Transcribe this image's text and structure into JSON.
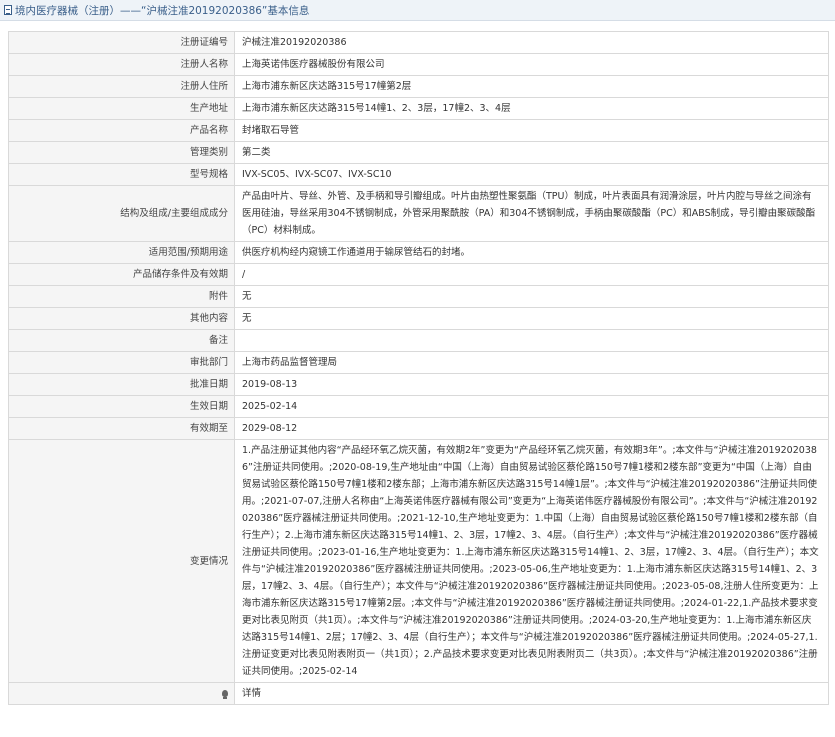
{
  "header": {
    "title": "境内医疗器械（注册）——“沪械注准20192020386”基本信息"
  },
  "rows": [
    {
      "label": "注册证编号",
      "value": "沪械注准20192020386"
    },
    {
      "label": "注册人名称",
      "value": "上海英诺伟医疗器械股份有限公司"
    },
    {
      "label": "注册人住所",
      "value": "上海市浦东新区庆达路315号17幢第2层"
    },
    {
      "label": "生产地址",
      "value": "上海市浦东新区庆达路315号14幢1、2、3层，17幢2、3、4层"
    },
    {
      "label": "产品名称",
      "value": "封堵取石导管"
    },
    {
      "label": "管理类别",
      "value": "第二类"
    },
    {
      "label": "型号规格",
      "value": "IVX-SC05、IVX-SC07、IVX-SC10"
    },
    {
      "label": "结构及组成/主要组成成分",
      "value": "产品由叶片、导丝、外管、及手柄和导引瓣组成。叶片由热塑性聚氨酯（TPU）制成，叶片表面具有润滑涂层，叶片内腔与导丝之间涂有医用硅油，导丝采用304不锈钢制成，外管采用聚酰胺（PA）和304不锈钢制成，手柄由聚碳酸酯（PC）和ABS制成，导引瓣由聚碳酸酯（PC）材料制成。"
    },
    {
      "label": "适用范围/预期用途",
      "value": "供医疗机构经内窥镜工作通道用于输尿管结石的封堵。"
    },
    {
      "label": "产品储存条件及有效期",
      "value": "/"
    },
    {
      "label": "附件",
      "value": "无"
    },
    {
      "label": "其他内容",
      "value": "无"
    },
    {
      "label": "备注",
      "value": ""
    },
    {
      "label": "审批部门",
      "value": "上海市药品监督管理局"
    },
    {
      "label": "批准日期",
      "value": "2019-08-13"
    },
    {
      "label": "生效日期",
      "value": "2025-02-14"
    },
    {
      "label": "有效期至",
      "value": "2029-08-12"
    },
    {
      "label": "变更情况",
      "value": "1.产品注册证其他内容“产品经环氧乙烷灭菌，有效期2年”变更为“产品经环氧乙烷灭菌，有效期3年”。;本文件与“沪械注准20192020386”注册证共同使用。;2020-08-19,生产地址由“中国（上海）自由贸易试验区蔡伦路150号7幢1楼和2楼东部”变更为“中国（上海）自由贸易试验区蔡伦路150号7幢1楼和2楼东部；上海市浦东新区庆达路315号14幢1层”。;本文件与“沪械注准20192020386”注册证共同使用。;2021-07-07,注册人名称由“上海英诺伟医疗器械有限公司”变更为“上海英诺伟医疗器械股份有限公司”。;本文件与“沪械注准20192020386”医疗器械注册证共同使用。;2021-12-10,生产地址变更为：1.中国（上海）自由贸易试验区蔡伦路150号7幢1楼和2楼东部（自行生产）；2.上海市浦东新区庆达路315号14幢1、2、3层，17幢2、3、4层。（自行生产）;本文件与“沪械注准20192020386”医疗器械注册证共同使用。;2023-01-16,生产地址变更为：1.上海市浦东新区庆达路315号14幢1、2、3层，17幢2、3、4层。（自行生产）；本文件与“沪械注准20192020386”医疗器械注册证共同使用。;2023-05-06,生产地址变更为：1.上海市浦东新区庆达路315号14幢1、2、3层，17幢2、3、4层。（自行生产）；本文件与“沪械注准20192020386”医疗器械注册证共同使用。;2023-05-08,注册人住所变更为：上海市浦东新区庆达路315号17幢第2层。;本文件与“沪械注准20192020386”医疗器械注册证共同使用。;2024-01-22,1.产品技术要求变更对比表见附页（共1页）。;本文件与“沪械注准20192020386”注册证共同使用。;2024-03-20,生产地址变更为：1.上海市浦东新区庆达路315号14幢1、2层；17幢2、3、4层（自行生产）；本文件与“沪械注准20192020386”医疗器械注册证共同使用。;2024-05-27,1.注册证变更对比表见附表附页一（共1页）；2.产品技术要求变更对比表见附表附页二（共3页）。;本文件与“沪械注准20192020386”注册证共同使用。;2025-02-14"
    }
  ],
  "footer": {
    "link_text": "详情"
  }
}
